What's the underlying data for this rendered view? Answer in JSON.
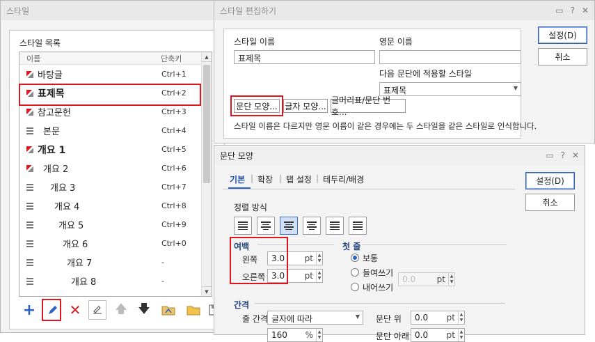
{
  "style_window": {
    "title": "스타일",
    "list_title": "스타일 목록",
    "col_name": "이름",
    "col_shortcut": "단축키",
    "items": [
      {
        "name": "바탕글",
        "shortcut": "Ctrl+1"
      },
      {
        "name": "표제목",
        "shortcut": "Ctrl+2"
      },
      {
        "name": "참고문헌",
        "shortcut": "Ctrl+3"
      },
      {
        "name": "본문",
        "shortcut": "Ctrl+4"
      },
      {
        "name": "개요 1",
        "shortcut": "Ctrl+5"
      },
      {
        "name": "개요 2",
        "shortcut": "Ctrl+6"
      },
      {
        "name": "개요 3",
        "shortcut": "Ctrl+7"
      },
      {
        "name": "개요 4",
        "shortcut": "Ctrl+8"
      },
      {
        "name": "개요 5",
        "shortcut": "Ctrl+9"
      },
      {
        "name": "개요 6",
        "shortcut": "Ctrl+0"
      },
      {
        "name": "개요 7",
        "shortcut": "-"
      },
      {
        "name": "개요 8",
        "shortcut": "-"
      }
    ],
    "toolbar_icons": [
      "add-style-icon",
      "edit-style-icon",
      "delete-style-icon",
      "edit-shape-icon",
      "move-up-icon",
      "move-down-icon",
      "import-icon",
      "open-folder-icon",
      "save-icon"
    ]
  },
  "edit_window": {
    "title": "스타일 편집하기",
    "style_name_label": "스타일 이름",
    "style_name_value": "표제목",
    "english_name_label": "영문 이름",
    "english_name_value": "",
    "next_style_label": "다음 문단에 적용할 스타일",
    "next_style_value": "표제목",
    "para_shape_button": "문단 모양...",
    "char_shape_button": "글자 모양...",
    "bullet_button": "글머리표/문단 번호...",
    "note": "스타일 이름은 다르지만 영문 이름이 같은 경우에는 두 스타일을 같은 스타일로 인식합니다.",
    "ok_button": "설정(D)",
    "cancel_button": "취소"
  },
  "para_window": {
    "title": "문단 모양",
    "tabs": [
      "기본",
      "확장",
      "탭 설정",
      "테두리/배경"
    ],
    "tab_sep": "|",
    "align_label": "정렬 방식",
    "margin_title": "여백",
    "left_label": "왼쪽",
    "left_value": "3.0",
    "right_label": "오른쪽",
    "right_value": "3.0",
    "unit": "pt",
    "indent_title": "첫 줄",
    "indent_options": [
      "보통",
      "들여쓰기",
      "내어쓰기"
    ],
    "indent_value": "0.0",
    "spacing_title": "간격",
    "line_spacing_label": "줄 간격",
    "line_spacing_value": "글자에 따라",
    "line_spacing_pct": "160",
    "pct_unit": "%",
    "para_above_label": "문단 위",
    "para_above_value": "0.0",
    "para_below_label": "문단 아래",
    "para_below_value": "0.0",
    "ok_button": "설정(D)",
    "cancel_button": "취소"
  },
  "accent_color": "#2a62c9",
  "highlight_color": "#e0141e"
}
